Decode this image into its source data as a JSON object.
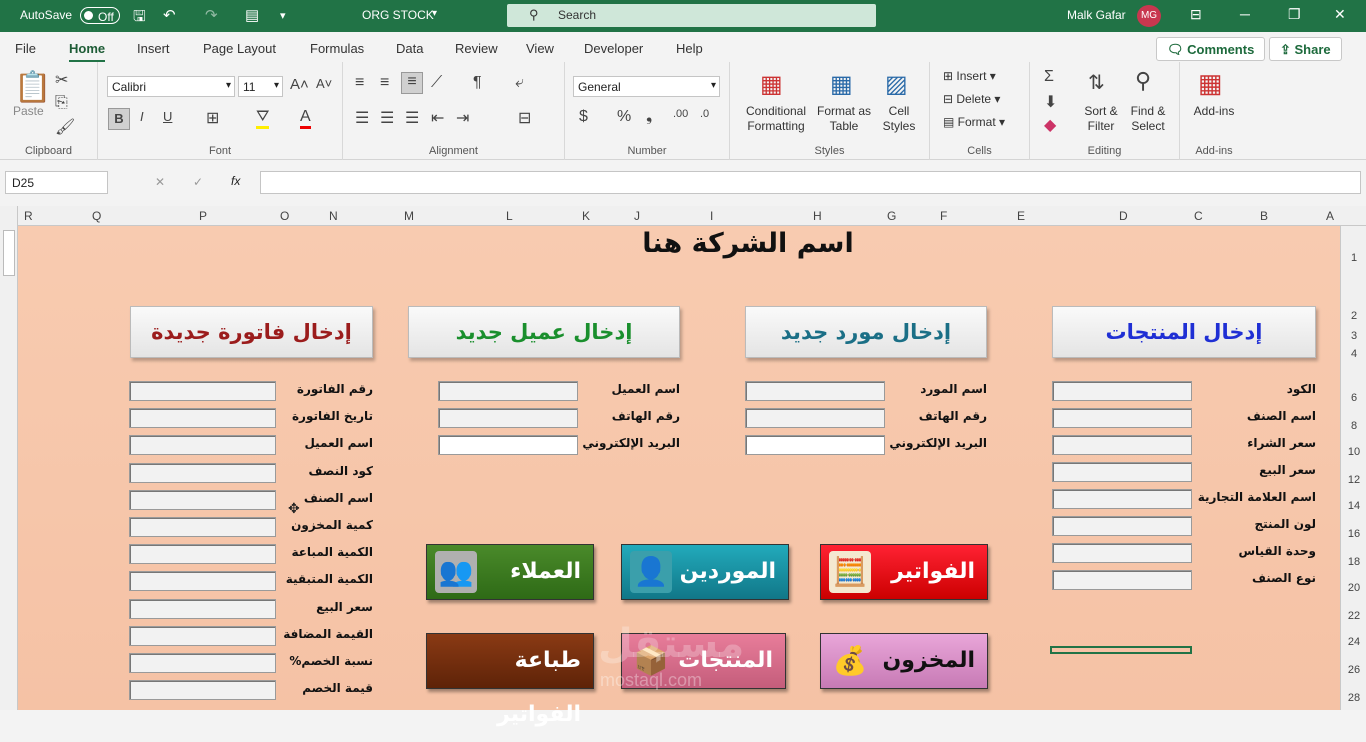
{
  "titlebar": {
    "autosave": "AutoSave",
    "autosave_state": "Off",
    "filename": "ORG STOCK",
    "search": "Search",
    "user": "Malk Gafar",
    "initials": "MG"
  },
  "menu": [
    "File",
    "Home",
    "Insert",
    "Page Layout",
    "Formulas",
    "Data",
    "Review",
    "View",
    "Developer",
    "Help"
  ],
  "header_buttons": {
    "comments": "Comments",
    "share": "Share"
  },
  "ribbon": {
    "clipboard": {
      "label": "Clipboard",
      "paste": "Paste"
    },
    "font": {
      "label": "Font",
      "name": "Calibri",
      "size": "11"
    },
    "alignment": {
      "label": "Alignment"
    },
    "number": {
      "label": "Number",
      "format": "General"
    },
    "styles": {
      "label": "Styles",
      "conditional": "Conditional",
      "formatting": "Formatting",
      "format_as": "Format as",
      "table": "Table",
      "cell": "Cell",
      "cell_styles": "Styles"
    },
    "cells": {
      "label": "Cells",
      "insert": "Insert",
      "delete": "Delete",
      "format": "Format"
    },
    "editing": {
      "label": "Editing",
      "sort": "Sort &",
      "filter": "Filter",
      "find": "Find &",
      "select": "Select"
    },
    "addins": {
      "label": "Add-ins",
      "btn": "Add-ins"
    }
  },
  "formula": {
    "namebox": "D25",
    "fx": "fx"
  },
  "columns": [
    "R",
    "Q",
    "P",
    "O",
    "N",
    "M",
    "L",
    "K",
    "J",
    "I",
    "H",
    "G",
    "F",
    "E",
    "D",
    "C",
    "B",
    "A"
  ],
  "rows": [
    "1",
    "2",
    "3",
    "4",
    "6",
    "8",
    "10",
    "12",
    "14",
    "16",
    "18",
    "20",
    "22",
    "24",
    "26",
    "28"
  ],
  "sheet": {
    "company": "اسم الشركة هنا",
    "products_btn": "إدخال المنتجات",
    "supplier_btn": "إدخال مورد جديد",
    "customer_btn": "إدخال عميل جديد",
    "invoice_btn": "إدخال فاتورة جديدة",
    "product_fields": [
      "الكود",
      "اسم الصنف",
      "سعر الشراء",
      "سعر البيع",
      "اسم العلامة التجارية",
      "لون المنتج",
      "وحدة القياس",
      "نوع الصنف"
    ],
    "supplier_fields": [
      "اسم المورد",
      "رقم الهاتف",
      "البريد الإلكتروني"
    ],
    "customer_fields": [
      "اسم العميل",
      "رقم الهاتف",
      "البريد الإلكتروني"
    ],
    "invoice_fields": [
      "رقم الفاتورة",
      "تاريخ الفاتورة",
      "اسم العميل",
      "كود النصف",
      "اسم الصنف",
      "كمية المخزون",
      "الكمية المباعة",
      "الكمية المتبقية",
      "سعر البيع",
      "القيمة المضافة",
      "نسبة الخصم%",
      "قيمة الخصم"
    ],
    "nav": {
      "invoices": "الفواتير",
      "suppliers": "الموردين",
      "customers": "العملاء",
      "stock": "المخزون",
      "products": "المنتجات",
      "print": "طباعة الفواتير"
    },
    "watermark": "مستقل",
    "watermark_url": "mostaql.com"
  }
}
